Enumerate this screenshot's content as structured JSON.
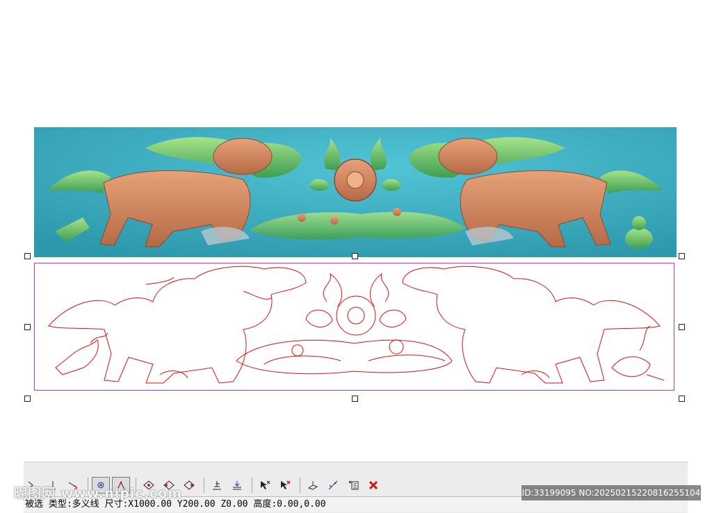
{
  "canvas": {
    "relief_colors": {
      "background": "#3fb0c4",
      "body": "#d38a62",
      "accent": "#6fcf6a"
    },
    "vector_color": "#dd1111",
    "selection_color": "#cc33cc"
  },
  "toolbar": {
    "buttons": [
      {
        "name": "tool-arrow-icon",
        "active": false
      },
      {
        "name": "tool-vertical-line-icon",
        "active": false
      },
      {
        "name": "tool-diagonal-line-icon",
        "active": false
      },
      {
        "name": "tool-snap-icon",
        "active": true
      },
      {
        "name": "tool-axis-icon",
        "active": true
      },
      {
        "name": "tool-node-diamond-icon",
        "active": false
      },
      {
        "name": "tool-node-diamond-2-icon",
        "active": false
      },
      {
        "name": "tool-node-diamond-3-icon",
        "active": false
      },
      {
        "name": "tool-align-icon",
        "active": false
      },
      {
        "name": "tool-align-down-icon",
        "active": false
      },
      {
        "name": "tool-select-x-icon",
        "active": false
      },
      {
        "name": "tool-select-x-red-icon",
        "active": false
      },
      {
        "name": "tool-transform-icon",
        "active": false
      },
      {
        "name": "tool-mirror-icon",
        "active": false
      },
      {
        "name": "tool-list-icon",
        "active": false
      },
      {
        "name": "tool-delete-icon",
        "active": false
      }
    ]
  },
  "status": {
    "text": "被选 类型:多义线 尺寸:X1000.00 Y200.00 Z0.00 高度:0.00,0.00"
  },
  "watermark": {
    "left": "昵图网 www.nipic.com",
    "right": "ID:33199095 NO:20250215220816255104"
  }
}
